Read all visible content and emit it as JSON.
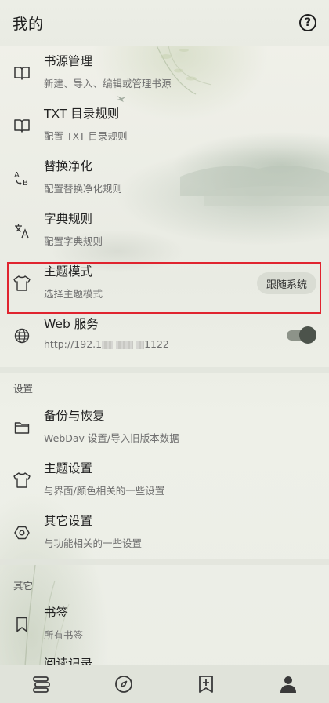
{
  "header": {
    "title": "我的",
    "help_icon": "question-circle-icon"
  },
  "items": [
    {
      "name": "book-source",
      "icon": "open-book-icon",
      "label": "书源管理",
      "desc": "新建、导入、编辑或管理书源"
    },
    {
      "name": "txt-toc-rule",
      "icon": "open-book-icon",
      "label": "TXT 目录规则",
      "desc": "配置 TXT 目录规则"
    },
    {
      "name": "replace-purify",
      "icon": "replace-ab-icon",
      "label": "替换净化",
      "desc": "配置替换净化规则"
    },
    {
      "name": "dict-rule",
      "icon": "translate-icon",
      "label": "字典规则",
      "desc": "配置字典规则"
    },
    {
      "name": "theme-mode",
      "icon": "tshirt-icon",
      "label": "主题模式",
      "desc": "选择主题模式",
      "chip": "跟随系统"
    },
    {
      "name": "web-service",
      "icon": "globe-icon",
      "label": "Web 服务",
      "desc_prefix": "http://192.1",
      "desc_suffix": "1122",
      "toggle_on": true
    }
  ],
  "sections": {
    "settings": {
      "title": "设置",
      "items": [
        {
          "name": "backup-restore",
          "icon": "folder-icon",
          "label": "备份与恢复",
          "desc": "WebDav 设置/导入旧版本数据"
        },
        {
          "name": "theme-settings",
          "icon": "tshirt-icon",
          "label": "主题设置",
          "desc": "与界面/颜色相关的一些设置"
        },
        {
          "name": "other-settings",
          "icon": "hexagon-gear-icon",
          "label": "其它设置",
          "desc": "与功能相关的一些设置"
        }
      ]
    },
    "other": {
      "title": "其它",
      "items": [
        {
          "name": "bookmarks",
          "icon": "bookmark-icon",
          "label": "书签",
          "desc": "所有书签"
        },
        {
          "name": "read-record",
          "icon": "history-icon",
          "label": "阅读记录",
          "desc": ""
        }
      ]
    }
  },
  "bottom_nav": [
    {
      "name": "bookshelf",
      "icon": "bookshelf-icon"
    },
    {
      "name": "discover",
      "icon": "compass-icon"
    },
    {
      "name": "rss",
      "icon": "bookmark-plus-icon"
    },
    {
      "name": "my",
      "icon": "person-icon",
      "active": true
    }
  ],
  "colors": {
    "highlight": "#e0242f",
    "background": "#eef0ea",
    "nav": "#e0e3da"
  }
}
